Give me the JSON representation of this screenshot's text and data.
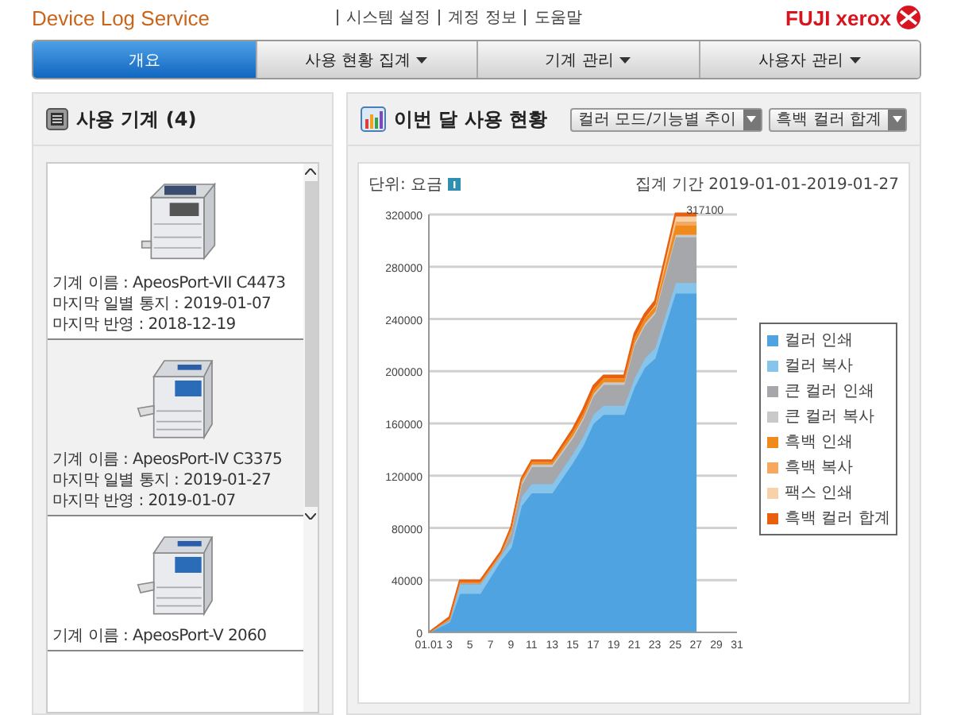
{
  "header": {
    "logo": "Device Log Service",
    "links": [
      "시스템 설정",
      "계정 정보",
      "도움말"
    ],
    "brand": "FUJI xerox"
  },
  "tabs": [
    {
      "label": "개요",
      "selected": true,
      "dropdown": false
    },
    {
      "label": "사용 현황 집계",
      "selected": false,
      "dropdown": true
    },
    {
      "label": "기계 관리",
      "selected": false,
      "dropdown": true
    },
    {
      "label": "사용자 관리",
      "selected": false,
      "dropdown": true
    }
  ],
  "machines_panel": {
    "title": "사용 기계 (4)",
    "items": [
      {
        "kind": "tall",
        "selected": false,
        "lines": [
          "기계 이름 : ApeosPort-VII C4473",
          "마지막 일별 통지 : 2019-01-07",
          "마지막 반영 : 2018-12-19"
        ]
      },
      {
        "kind": "tray",
        "selected": true,
        "lines": [
          "기계 이름 : ApeosPort-IV C3375",
          "마지막 일별 통지 : 2019-01-27",
          "마지막 반영 : 2019-01-07"
        ]
      },
      {
        "kind": "tray",
        "selected": false,
        "lines": [
          "기계 이름 : ApeosPort-V 2060"
        ]
      }
    ]
  },
  "usage_panel": {
    "title": "이번 달 사용 현황",
    "selects": [
      "컬러 모드/기능별 추이",
      "흑백 컬러 합계"
    ],
    "unit_label": "단위: 요금",
    "axis_start_date": "01.01",
    "period": "집계 기간 2019-01-01-2019-01-27",
    "chart_data": {
      "type": "area",
      "stacked": true,
      "x": [
        1,
        3,
        4,
        6,
        8,
        9,
        10,
        11,
        13,
        15,
        16,
        17,
        18,
        20,
        21,
        22,
        23,
        25,
        27
      ],
      "xlim": [
        1,
        31
      ],
      "ylim": [
        0,
        320000
      ],
      "grid": true,
      "legend": true,
      "xticks": [
        3,
        5,
        7,
        9,
        11,
        13,
        15,
        17,
        19,
        21,
        23,
        25,
        27,
        29,
        31
      ],
      "yticks": [
        0,
        40000,
        80000,
        120000,
        160000,
        200000,
        240000,
        280000,
        320000
      ],
      "series": [
        {
          "name": "컬러 인쇄",
          "color": "#4fa3e0",
          "values": [
            0,
            8000,
            30000,
            30000,
            55000,
            65000,
            97000,
            107000,
            107000,
            130000,
            143000,
            160000,
            167000,
            167000,
            188000,
            203000,
            210000,
            260000,
            260000
          ]
        },
        {
          "name": "컬러 복사",
          "color": "#86c4ec",
          "values": [
            0,
            1000,
            7000,
            7000,
            4000,
            5000,
            7000,
            7000,
            7000,
            7000,
            7000,
            7000,
            7000,
            7000,
            7000,
            7000,
            8000,
            8000,
            8000
          ]
        },
        {
          "name": "큰 컬러 인쇄",
          "color": "#a6a7ab",
          "values": [
            0,
            1000,
            1000,
            1000,
            1000,
            7000,
            9000,
            13000,
            13000,
            12000,
            13000,
            14000,
            16000,
            16000,
            25000,
            25000,
            26000,
            35000,
            35000
          ]
        },
        {
          "name": "큰 컬러 복사",
          "color": "#c9c9cb",
          "values": [
            0,
            0,
            0,
            0,
            0,
            1000,
            2000,
            2000,
            2000,
            2000,
            2000,
            2000,
            2000,
            2000,
            2000,
            2000,
            2000,
            2000,
            2000
          ]
        },
        {
          "name": "흑백 인쇄",
          "color": "#f08a1c",
          "values": [
            0,
            1000,
            1000,
            1000,
            1000,
            2000,
            2000,
            2000,
            2000,
            3000,
            3000,
            3000,
            3000,
            3000,
            4000,
            4000,
            4000,
            7000,
            7000
          ]
        },
        {
          "name": "흑백 복사",
          "color": "#f4a860",
          "values": [
            0,
            0,
            0,
            0,
            0,
            0,
            0,
            0,
            0,
            0,
            0,
            0,
            0,
            0,
            0,
            0,
            0,
            3000,
            3000
          ]
        },
        {
          "name": "팩스 인쇄",
          "color": "#f7d2a8",
          "values": [
            0,
            0,
            0,
            0,
            0,
            0,
            0,
            0,
            0,
            0,
            0,
            0,
            0,
            0,
            0,
            0,
            1000,
            4000,
            4000
          ]
        },
        {
          "name": "흑백 컬러 합계",
          "color": "#e8600e",
          "values": [
            0,
            1000,
            1000,
            1000,
            1000,
            1000,
            1000,
            1000,
            1000,
            2000,
            3000,
            3000,
            2000,
            2000,
            3000,
            3000,
            3000,
            2000,
            2000
          ]
        }
      ],
      "annotations": [
        {
          "x": 27,
          "y": 317100,
          "text": "317100"
        }
      ]
    }
  }
}
